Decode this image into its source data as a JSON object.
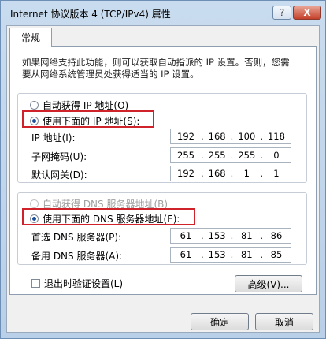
{
  "window": {
    "title": "Internet 协议版本 4 (TCP/IPv4) 属性",
    "help_glyph": "?",
    "close_glyph": "X"
  },
  "tabs": [
    {
      "label": "常规"
    }
  ],
  "description": "如果网络支持此功能，则可以获取自动指派的 IP 设置。否则，您需要从网络系统管理员处获得适当的 IP 设置。",
  "ip_section": {
    "auto_option": "自动获得 IP 地址(O)",
    "manual_option": "使用下面的 IP 地址(S):",
    "selected": "manual",
    "fields": [
      {
        "label": "IP 地址(I):",
        "octets": [
          "192",
          "168",
          "100",
          "118"
        ]
      },
      {
        "label": "子网掩码(U):",
        "octets": [
          "255",
          "255",
          "255",
          "0"
        ]
      },
      {
        "label": "默认网关(D):",
        "octets": [
          "192",
          "168",
          "1",
          "1"
        ]
      }
    ]
  },
  "dns_section": {
    "auto_option": "自动获得 DNS 服务器地址(B)",
    "manual_option": "使用下面的 DNS 服务器地址(E):",
    "selected": "manual",
    "fields": [
      {
        "label": "首选 DNS 服务器(P):",
        "octets": [
          "61",
          "153",
          "81",
          "86"
        ]
      },
      {
        "label": "备用 DNS 服务器(A):",
        "octets": [
          "61",
          "153",
          "81",
          "85"
        ]
      }
    ]
  },
  "validate_on_exit": {
    "label": "退出时验证设置(L)",
    "checked": false
  },
  "buttons": {
    "advanced": "高级(V)...",
    "ok": "确定",
    "cancel": "取消"
  },
  "colors": {
    "highlight_box": "#d0222a",
    "title_gradient": "#c9dcef"
  }
}
